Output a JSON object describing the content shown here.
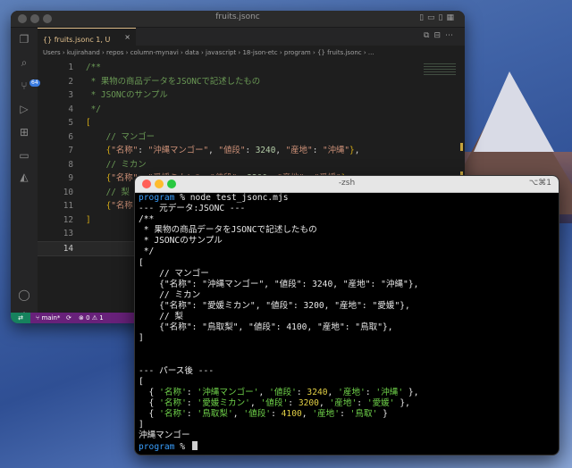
{
  "vscode": {
    "window_title": "fruits.jsonc",
    "tab_label": "{} fruits.jsonc 1, U",
    "breadcrumb": "Users › kujirahand › repos › column-mynavi › data › javascript › 18-json-etc › program › {} fruits.jsonc › ...",
    "scm_badge": "64",
    "code_lines": [
      {
        "n": "1",
        "html": "<span class='cm'>/**</span>"
      },
      {
        "n": "2",
        "html": "<span class='cm'> * 果物の商品データをJSONCで記述したもの</span>"
      },
      {
        "n": "3",
        "html": "<span class='cm'> * JSONCのサンプル</span>"
      },
      {
        "n": "4",
        "html": "<span class='cm'> */</span>"
      },
      {
        "n": "5",
        "html": "<span class='br'>[</span>"
      },
      {
        "n": "6",
        "html": "    <span class='cm'>// マンゴー</span>"
      },
      {
        "n": "7",
        "html": "    <span class='br'>{</span><span class='key'>\"名称\"</span><span class='pun'>: </span><span class='str'>\"沖縄マンゴー\"</span><span class='pun'>, </span><span class='key'>\"値段\"</span><span class='pun'>: </span><span class='num'>3240</span><span class='pun'>, </span><span class='key'>\"産地\"</span><span class='pun'>: </span><span class='str'>\"沖縄\"</span><span class='br'>}</span><span class='pun'>,</span>"
      },
      {
        "n": "8",
        "html": "    <span class='cm'>// ミカン</span>"
      },
      {
        "n": "9",
        "html": "    <span class='br'>{</span><span class='key'>\"名称\"</span><span class='pun'>: </span><span class='str'>\"愛媛ミカン\"</span><span class='pun'>, </span><span class='key'>\"値段\"</span><span class='pun'>: </span><span class='num'>3200</span><span class='pun'>, </span><span class='key'>\"産地\"</span><span class='pun'>: </span><span class='str'>\"愛媛\"</span><span class='br'>}</span><span class='pun'>,</span>"
      },
      {
        "n": "10",
        "html": "    <span class='cm'>// 梨</span>"
      },
      {
        "n": "11",
        "html": "    <span class='br'>{</span><span class='key'>\"名称\"</span>"
      },
      {
        "n": "12",
        "html": "<span class='br'>]</span>"
      },
      {
        "n": "13",
        "html": ""
      },
      {
        "n": "14",
        "html": ""
      }
    ],
    "status": {
      "branch": "main*",
      "sync": "⟳",
      "problems": "⊗ 0 ⚠ 1"
    }
  },
  "terminal": {
    "title": "-zsh",
    "shortcut": "⌥⌘1",
    "lines": [
      {
        "html": "<span class='prompt'>program</span> % node test_jsonc.mjs"
      },
      {
        "html": "--- 元データ:JSONC ---"
      },
      {
        "html": "/**"
      },
      {
        "html": " * 果物の商品データをJSONCで記述したもの"
      },
      {
        "html": " * JSONCのサンプル"
      },
      {
        "html": " */"
      },
      {
        "html": "["
      },
      {
        "html": "    // マンゴー"
      },
      {
        "html": "    {\"名称\": \"沖縄マンゴー\", \"値段\": 3240, \"産地\": \"沖縄\"},"
      },
      {
        "html": "    // ミカン"
      },
      {
        "html": "    {\"名称\": \"愛媛ミカン\", \"値段\": 3200, \"産地\": \"愛媛\"},"
      },
      {
        "html": "    // 梨"
      },
      {
        "html": "    {\"名称\": \"鳥取梨\", \"値段\": 4100, \"産地\": \"鳥取\"},"
      },
      {
        "html": "]"
      },
      {
        "html": ""
      },
      {
        "html": ""
      },
      {
        "html": "--- パース後 ---"
      },
      {
        "html": "["
      },
      {
        "html": "  { <span class='tk'>'名称'</span>: <span class='ts'>'沖縄マンゴー'</span>, <span class='tk'>'値段'</span>: <span class='tn'>3240</span>, <span class='tk'>'産地'</span>: <span class='ts'>'沖縄'</span> },"
      },
      {
        "html": "  { <span class='tk'>'名称'</span>: <span class='ts'>'愛媛ミカン'</span>, <span class='tk'>'値段'</span>: <span class='tn'>3200</span>, <span class='tk'>'産地'</span>: <span class='ts'>'愛媛'</span> },"
      },
      {
        "html": "  { <span class='tk'>'名称'</span>: <span class='ts'>'鳥取梨'</span>, <span class='tk'>'値段'</span>: <span class='tn'>4100</span>, <span class='tk'>'産地'</span>: <span class='ts'>'鳥取'</span> }"
      },
      {
        "html": "]"
      },
      {
        "html": "沖縄マンゴー"
      },
      {
        "html": "<span class='prompt'>program</span> % <span class='cursor'></span>"
      }
    ]
  }
}
